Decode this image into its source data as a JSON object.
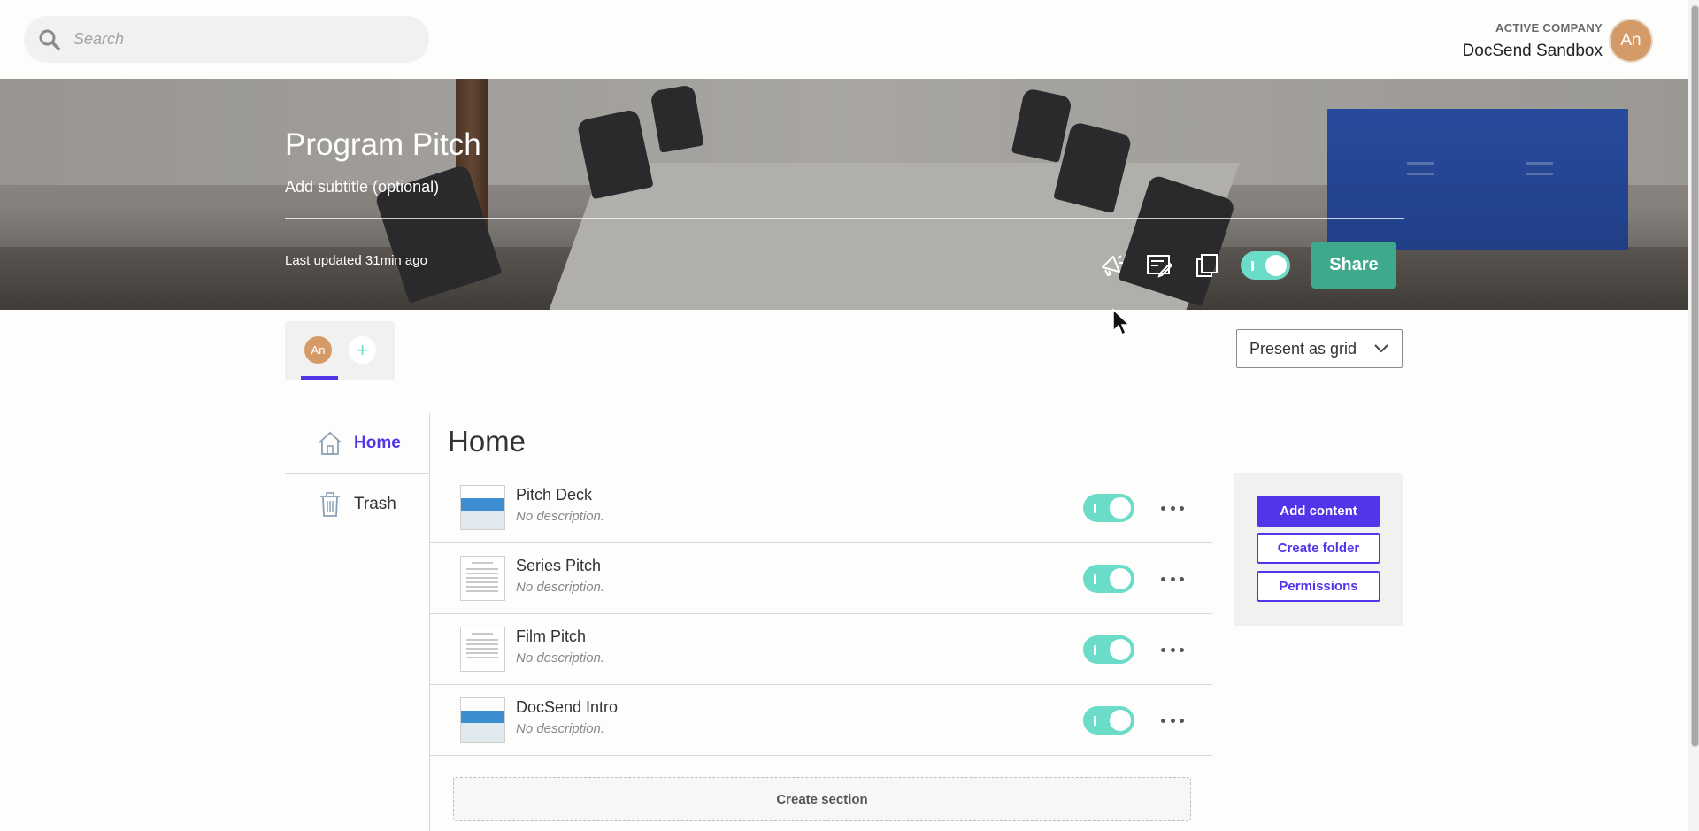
{
  "header": {
    "search_placeholder": "Search",
    "company_label": "ACTIVE COMPANY",
    "company_name": "DocSend Sandbox",
    "avatar_initials": "An"
  },
  "hero": {
    "title": "Program Pitch",
    "subtitle_placeholder": "Add subtitle (optional)",
    "last_updated": "Last updated 31min ago",
    "tools": [
      "megaphone-icon",
      "edit-form-icon",
      "copy-icon"
    ],
    "share_label": "Share",
    "toggle_on": true
  },
  "collaborators": {
    "avatar_initials": "An",
    "add_symbol": "+"
  },
  "present_mode": {
    "value": "Present as grid"
  },
  "sidenav": {
    "items": [
      {
        "label": "Home",
        "icon": "home-icon",
        "active": true
      },
      {
        "label": "Trash",
        "icon": "trash-icon",
        "active": false
      }
    ]
  },
  "main": {
    "title": "Home",
    "documents": [
      {
        "name": "Pitch Deck",
        "description": "No description.",
        "enabled": true,
        "thumb": "slide"
      },
      {
        "name": "Series Pitch",
        "description": "No description.",
        "enabled": true,
        "thumb": "doc"
      },
      {
        "name": "Film Pitch",
        "description": "No description.",
        "enabled": true,
        "thumb": "doc"
      },
      {
        "name": "DocSend Intro",
        "description": "No description.",
        "enabled": true,
        "thumb": "slide"
      }
    ],
    "create_section_label": "Create section"
  },
  "actions": {
    "add_content": "Add content",
    "create_folder": "Create folder",
    "permissions": "Permissions"
  },
  "colors": {
    "accent": "#5135e8",
    "toggle": "#6bdcc8",
    "share": "#3fa98e"
  }
}
